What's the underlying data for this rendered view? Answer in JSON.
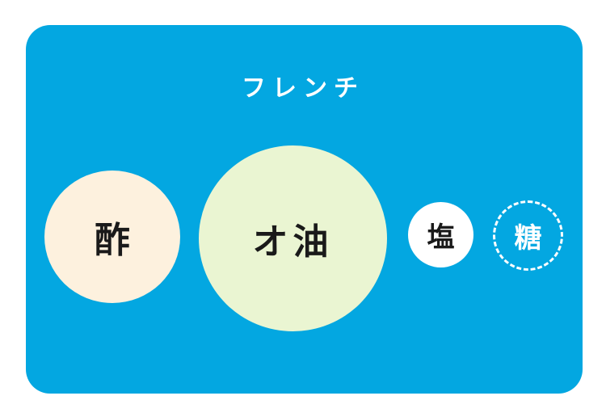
{
  "title": "フレンチ",
  "colors": {
    "panel": "#03a7e1",
    "vinegar_circle": "#fdf1de",
    "oil_circle": "#eaf5d2",
    "salt_circle": "#ffffff",
    "sugar_outline": "#ffffff"
  },
  "ingredients": [
    {
      "label": "酢",
      "style": "filled"
    },
    {
      "label": "オ油",
      "style": "filled"
    },
    {
      "label": "塩",
      "style": "filled"
    },
    {
      "label": "糖",
      "style": "dashed-outline"
    }
  ]
}
